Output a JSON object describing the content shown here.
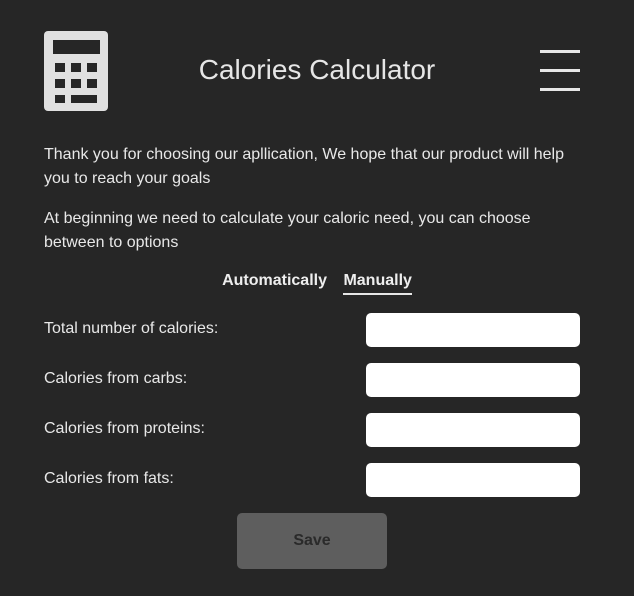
{
  "header": {
    "title": "Calories Calculator",
    "logo_icon": "calculator-icon",
    "menu_icon": "hamburger-menu-icon"
  },
  "intro": {
    "paragraph1": "Thank you for choosing our apllication, We hope that our product will help you to reach your goals",
    "paragraph2": "At beginning we need to calculate your caloric need, you can choose between to options"
  },
  "tabs": {
    "automatic_label": "Automatically",
    "manual_label": "Manually",
    "active": "Manually"
  },
  "form": {
    "fields": [
      {
        "label": "Total number of calories:",
        "value": "",
        "placeholder": ""
      },
      {
        "label": "Calories from carbs:",
        "value": "",
        "placeholder": ""
      },
      {
        "label": "Calories from proteins:",
        "value": "",
        "placeholder": ""
      },
      {
        "label": "Calories from fats:",
        "value": "",
        "placeholder": ""
      }
    ],
    "save_label": "Save"
  },
  "colors": {
    "background": "#262626",
    "text": "#e8e8e8",
    "input_bg": "#ffffff",
    "button_bg": "#5e5e5e",
    "icon": "#e0e0e0"
  }
}
